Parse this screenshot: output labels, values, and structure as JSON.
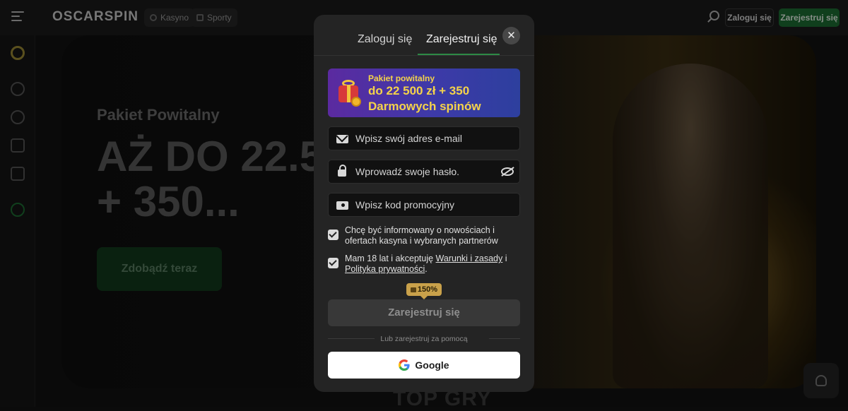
{
  "header": {
    "logo": "OSCARSPIN",
    "nav": [
      {
        "label": "Kasyno",
        "icon": "casino-icon"
      },
      {
        "label": "Sporty",
        "icon": "sports-icon"
      }
    ],
    "login_label": "Zaloguj się",
    "register_label": "Zarejestruj się"
  },
  "hero": {
    "subtitle": "Pakiet Powitalny",
    "title": "AŻ DO 22.5\n+ 350...",
    "cta_label": "Zdobądź teraz"
  },
  "section_title": "TOP GRY",
  "modal": {
    "tabs": [
      {
        "label": "Zaloguj się",
        "active": false
      },
      {
        "label": "Zarejestruj się",
        "active": true
      }
    ],
    "close_label": "✕",
    "promo": {
      "label": "Pakiet powitalny",
      "amount_line1": "do 22 500 zł + 350",
      "amount_line2": "Darmowych spinów"
    },
    "email_placeholder": "Wpisz swój adres e-mail",
    "password_placeholder": "Wprowadź swoje hasło.",
    "promo_code_placeholder": "Wpisz kod promocyjny",
    "consent_marketing": "Chcę być informowany o nowościach i ofertach kasyna i wybranych partnerów",
    "consent_terms": {
      "prefix": "Mam 18 lat i akceptuję ",
      "terms_link": "Warunki i zasady",
      "middle": " i ",
      "privacy_link": "Polityka prywatności",
      "suffix": "."
    },
    "bonus_tag": "150%",
    "submit_label": "Zarejestruj się",
    "divider_text": "Lub zarejestruj za pomocą",
    "google_label": "Google"
  },
  "colors": {
    "accent_green": "#1d6d32",
    "tab_underline": "#2d8a45",
    "promo_gold": "#f4d34a",
    "bonus_gold": "#c9a14a"
  }
}
